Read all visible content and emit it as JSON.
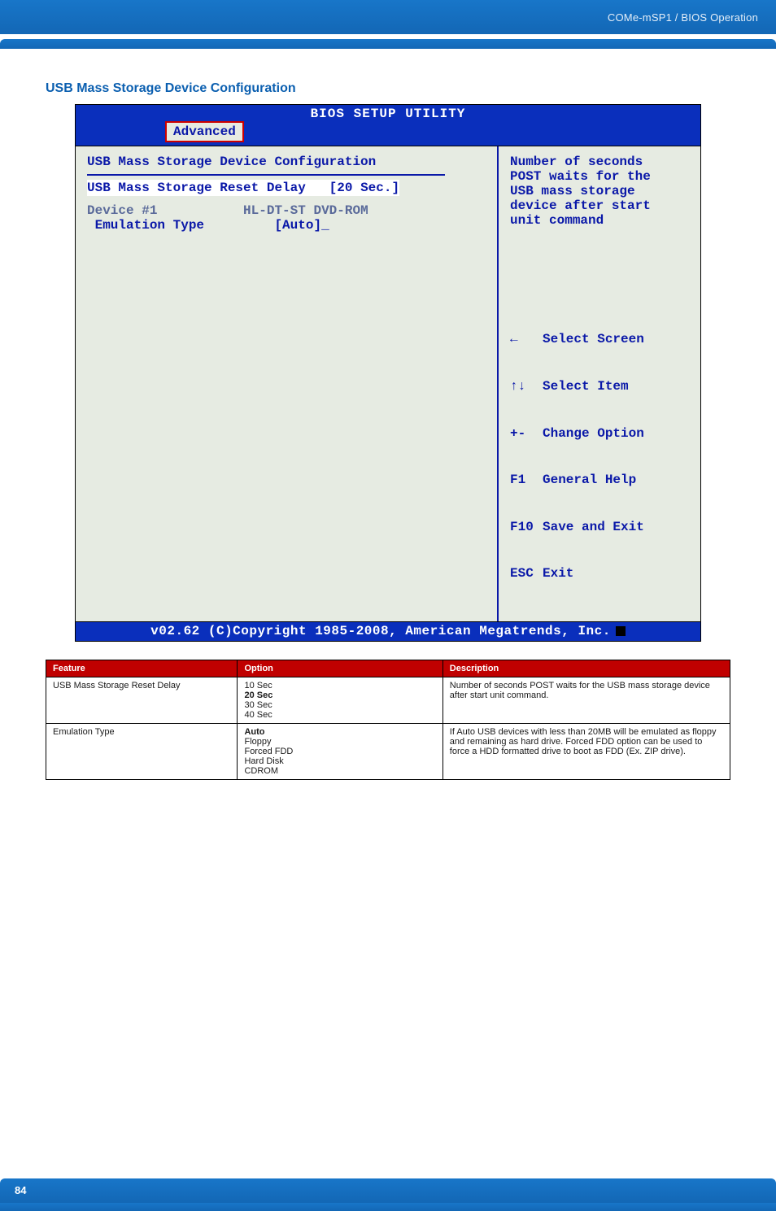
{
  "header": {
    "breadcrumb": "COMe-mSP1 / BIOS Operation"
  },
  "section_title": "USB Mass Storage Device Configuration",
  "bios": {
    "title": "BIOS SETUP UTILITY",
    "tab": "Advanced",
    "panel_heading": "USB Mass Storage Device Configuration",
    "rows": {
      "reset_delay_label": "USB Mass Storage Reset Delay",
      "reset_delay_value": "[20 Sec.]",
      "device_label": "Device #1",
      "device_value": "HL-DT-ST DVD-ROM",
      "emulation_label": " Emulation Type",
      "emulation_value": "[Auto]_"
    },
    "help": {
      "l1": "Number of seconds",
      "l2": "POST waits for the",
      "l3": "USB mass storage",
      "l4": "device after start",
      "l5": "unit command"
    },
    "keys": [
      {
        "key": "←",
        "label": "Select Screen"
      },
      {
        "key": "↑↓",
        "label": "Select Item"
      },
      {
        "key": "+-",
        "label": "Change Option"
      },
      {
        "key": "F1",
        "label": "General Help"
      },
      {
        "key": "F10",
        "label": "Save and Exit"
      },
      {
        "key": "ESC",
        "label": "Exit"
      }
    ],
    "footer": "v02.62 (C)Copyright 1985-2008, American Megatrends, Inc."
  },
  "table": {
    "headers": {
      "feature": "Feature",
      "option": "Option",
      "description": "Description"
    },
    "rows": [
      {
        "feature": "USB Mass Storage Reset Delay",
        "options": [
          "10 Sec",
          "20 Sec",
          "30 Sec",
          "40 Sec"
        ],
        "option_bold_index": 1,
        "description": "Number of seconds POST waits for the USB mass storage device after start unit command."
      },
      {
        "feature": "Emulation Type",
        "options": [
          "Auto",
          "Floppy",
          "Forced FDD",
          "Hard Disk",
          "CDROM"
        ],
        "option_bold_index": 0,
        "description": "If Auto USB devices with less than 20MB will be emulated as floppy and remaining as hard drive. Forced FDD option can be used to force a HDD formatted drive to boot as FDD (Ex. ZIP drive)."
      }
    ]
  },
  "page_number": "84"
}
